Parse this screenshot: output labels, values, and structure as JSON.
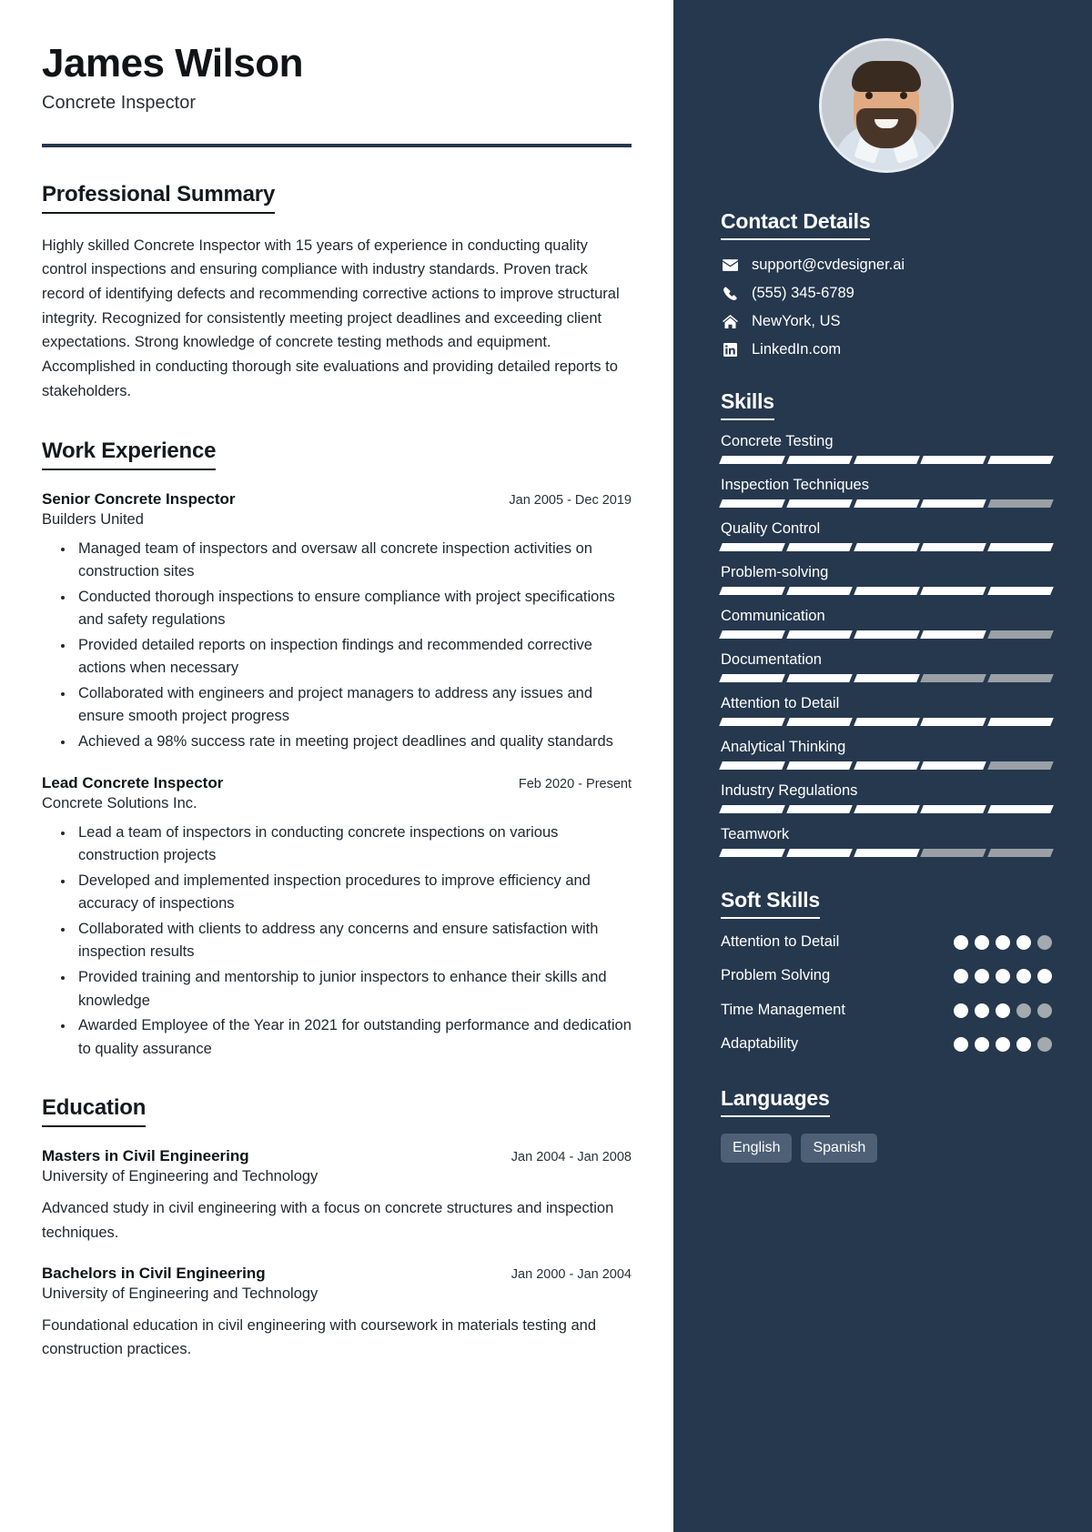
{
  "header": {
    "name": "James Wilson",
    "job_title": "Concrete Inspector"
  },
  "main": {
    "summary": {
      "heading": "Professional Summary",
      "text": "Highly skilled Concrete Inspector with 15 years of experience in conducting quality control inspections and ensuring compliance with industry standards. Proven track record of identifying defects and recommending corrective actions to improve structural integrity. Recognized for consistently meeting project deadlines and exceeding client expectations. Strong knowledge of concrete testing methods and equipment. Accomplished in conducting thorough site evaluations and providing detailed reports to stakeholders."
    },
    "experience": {
      "heading": "Work Experience",
      "entries": [
        {
          "role": "Senior Concrete Inspector",
          "date": "Jan 2005 - Dec 2019",
          "org": "Builders United",
          "bullets": [
            "Managed team of inspectors and oversaw all concrete inspection activities on construction sites",
            "Conducted thorough inspections to ensure compliance with project specifications and safety regulations",
            "Provided detailed reports on inspection findings and recommended corrective actions when necessary",
            "Collaborated with engineers and project managers to address any issues and ensure smooth project progress",
            "Achieved a 98% success rate in meeting project deadlines and quality standards"
          ]
        },
        {
          "role": "Lead Concrete Inspector",
          "date": "Feb 2020 - Present",
          "org": "Concrete Solutions Inc.",
          "bullets": [
            "Lead a team of inspectors in conducting concrete inspections on various construction projects",
            "Developed and implemented inspection procedures to improve efficiency and accuracy of inspections",
            "Collaborated with clients to address any concerns and ensure satisfaction with inspection results",
            "Provided training and mentorship to junior inspectors to enhance their skills and knowledge",
            "Awarded Employee of the Year in 2021 for outstanding performance and dedication to quality assurance"
          ]
        }
      ]
    },
    "education": {
      "heading": "Education",
      "entries": [
        {
          "degree": "Masters in Civil Engineering",
          "date": "Jan 2004 - Jan 2008",
          "school": "University of Engineering and Technology",
          "description": "Advanced study in civil engineering with a focus on concrete structures and inspection techniques."
        },
        {
          "degree": "Bachelors in Civil Engineering",
          "date": "Jan 2000 - Jan 2004",
          "school": "University of Engineering and Technology",
          "description": "Foundational education in civil engineering with coursework in materials testing and construction practices."
        }
      ]
    }
  },
  "sidebar": {
    "contact": {
      "heading": "Contact Details",
      "items": [
        {
          "icon": "envelope-icon",
          "value": "support@cvdesigner.ai"
        },
        {
          "icon": "phone-icon",
          "value": "(555) 345-6789"
        },
        {
          "icon": "home-icon",
          "value": "NewYork, US"
        },
        {
          "icon": "linkedin-icon",
          "value": "LinkedIn.com"
        }
      ]
    },
    "skills": {
      "heading": "Skills",
      "max": 5,
      "items": [
        {
          "label": "Concrete Testing",
          "level": 5
        },
        {
          "label": "Inspection Techniques",
          "level": 4
        },
        {
          "label": "Quality Control",
          "level": 5
        },
        {
          "label": "Problem-solving",
          "level": 5
        },
        {
          "label": "Communication",
          "level": 4
        },
        {
          "label": "Documentation",
          "level": 3
        },
        {
          "label": "Attention to Detail",
          "level": 5
        },
        {
          "label": "Analytical Thinking",
          "level": 4
        },
        {
          "label": "Industry Regulations",
          "level": 5
        },
        {
          "label": "Teamwork",
          "level": 3
        }
      ]
    },
    "soft_skills": {
      "heading": "Soft Skills",
      "max": 5,
      "items": [
        {
          "label": "Attention to Detail",
          "level": 4
        },
        {
          "label": "Problem Solving",
          "level": 5
        },
        {
          "label": "Time Management",
          "level": 3
        },
        {
          "label": "Adaptability",
          "level": 4
        }
      ]
    },
    "languages": {
      "heading": "Languages",
      "items": [
        "English",
        "Spanish"
      ]
    }
  },
  "colors": {
    "sidebar_bg": "#26384e",
    "rule": "#27374d",
    "chip_bg": "#4d6076",
    "muted_segment": "#9aa0a6",
    "text_dark": "#232830"
  }
}
